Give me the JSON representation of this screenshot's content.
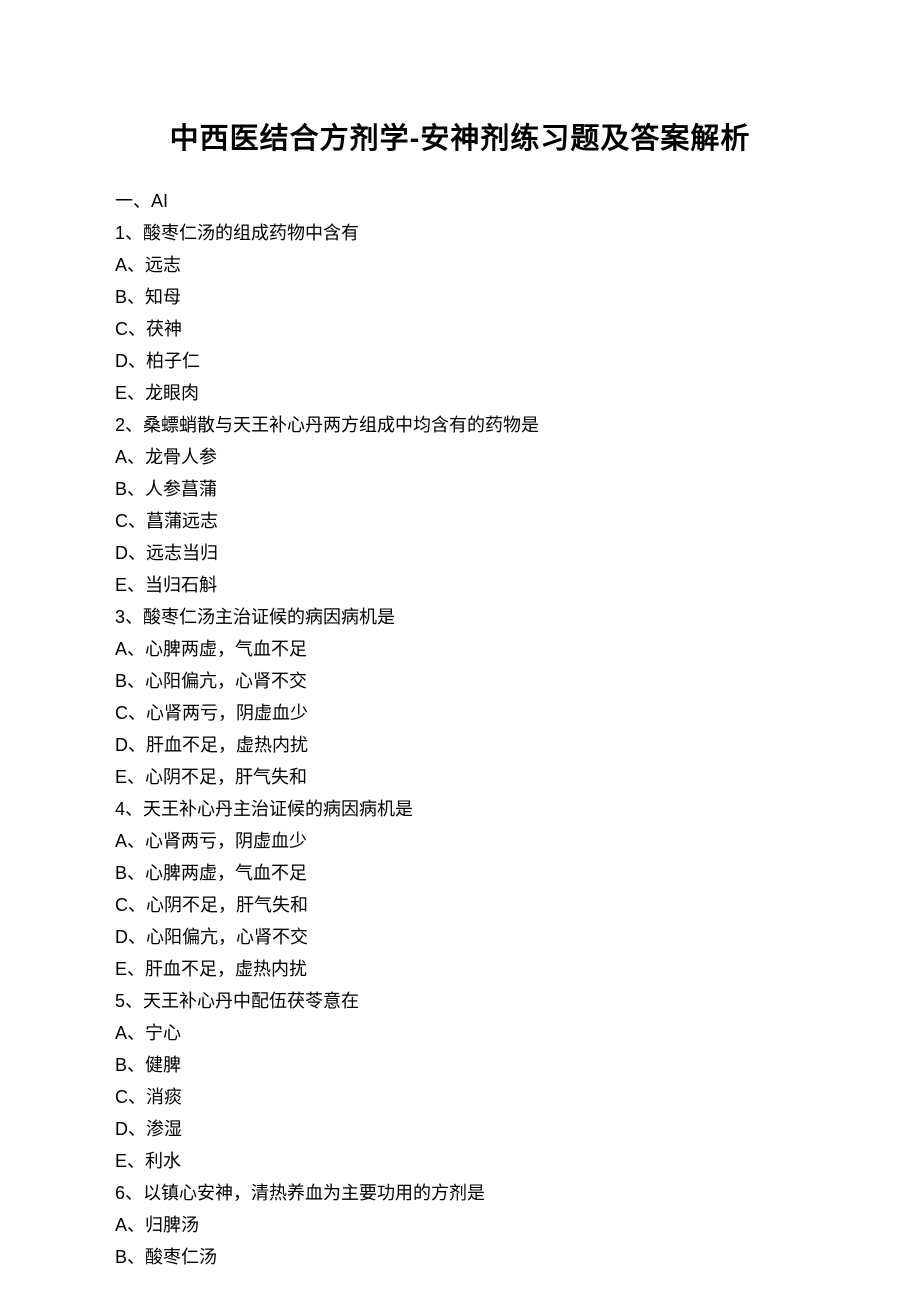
{
  "title": "中西医结合方剂学-安神剂练习题及答案解析",
  "section": "一、AI",
  "questions": [
    {
      "num": "1",
      "stem": "酸枣仁汤的组成药物中含有",
      "options": [
        "远志",
        "知母",
        "茯神",
        "柏子仁",
        "龙眼肉"
      ]
    },
    {
      "num": "2",
      "stem": "桑螵蛸散与天王补心丹两方组成中均含有的药物是",
      "options": [
        "龙骨人参",
        "人参菖蒲",
        "菖蒲远志",
        "远志当归",
        "当归石斛"
      ]
    },
    {
      "num": "3",
      "stem": "酸枣仁汤主治证候的病因病机是",
      "options": [
        "心脾两虚，气血不足",
        "心阳偏亢，心肾不交",
        "心肾两亏，阴虚血少",
        "肝血不足，虚热内扰",
        "心阴不足，肝气失和"
      ]
    },
    {
      "num": "4",
      "stem": "天王补心丹主治证候的病因病机是",
      "options": [
        "心肾两亏，阴虚血少",
        "心脾两虚，气血不足",
        "心阴不足，肝气失和",
        "心阳偏亢，心肾不交",
        "肝血不足，虚热内扰"
      ]
    },
    {
      "num": "5",
      "stem": "天王补心丹中配伍茯苓意在",
      "options": [
        "宁心",
        "健脾",
        "消痰",
        "渗湿",
        "利水"
      ]
    },
    {
      "num": "6",
      "stem": "以镇心安神，清热养血为主要功用的方剂是",
      "options": [
        "归脾汤",
        "酸枣仁汤"
      ]
    }
  ],
  "letters": [
    "A",
    "B",
    "C",
    "D",
    "E"
  ]
}
